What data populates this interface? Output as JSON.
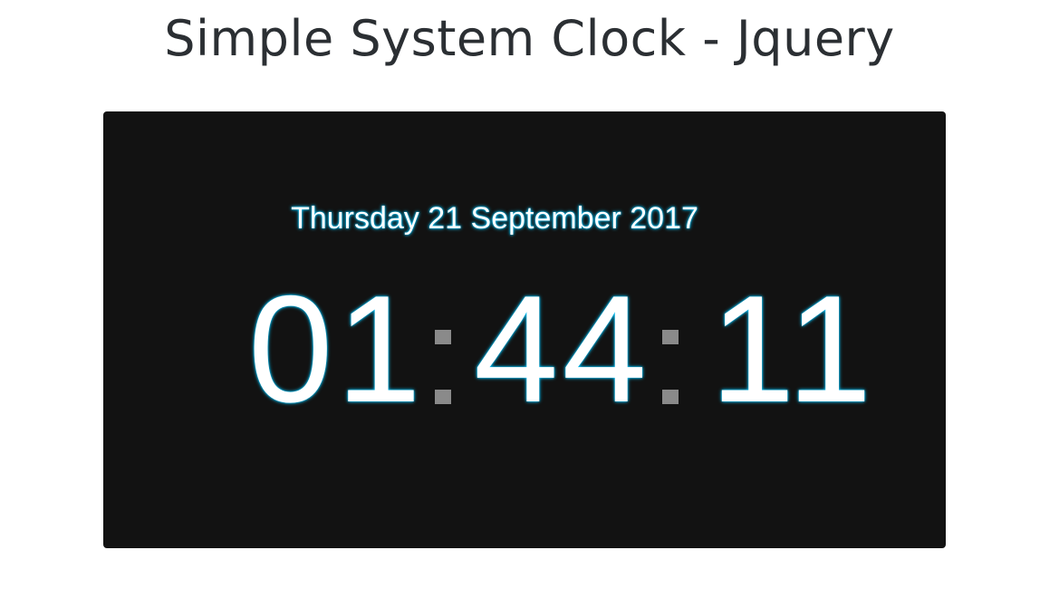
{
  "page": {
    "title": "Simple System Clock - Jquery"
  },
  "clock": {
    "date": "Thursday 21 September 2017",
    "hours": "01",
    "minutes": "44",
    "seconds": "11",
    "colors": {
      "panel_background": "#121212",
      "digit_color": "#ffffff",
      "glow_color": "#00c6ff",
      "separator_color": "#8a8a8a"
    }
  }
}
